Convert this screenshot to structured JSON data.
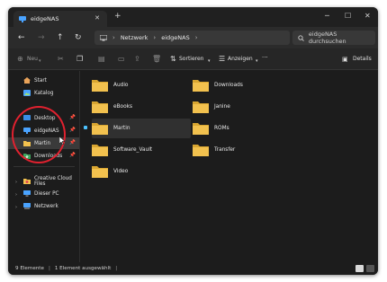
{
  "window": {
    "tab_title": "eidgeNAS",
    "close_tab": "✕",
    "new_tab": "+",
    "minimize": "─",
    "maximize": "☐",
    "close": "✕"
  },
  "nav": {
    "back": "←",
    "forward": "→",
    "up": "↑",
    "refresh": "↻",
    "breadcrumb": [
      "Netzwerk",
      "eidgeNAS"
    ],
    "search_placeholder": "eidgeNAS durchsuchen"
  },
  "toolbar": {
    "new_label": "Neu",
    "sort_label": "Sortieren",
    "view_label": "Anzeigen",
    "more_label": "···",
    "details_label": "Details"
  },
  "sidebar": {
    "items": [
      {
        "label": "Start",
        "icon": "home-icon"
      },
      {
        "label": "Katalog",
        "icon": "gallery-icon"
      },
      {
        "label": "Desktop",
        "icon": "desktop-icon",
        "pinned": true
      },
      {
        "label": "eidgeNAS",
        "icon": "network-drive-icon",
        "pinned": true
      },
      {
        "label": "Martin",
        "icon": "folder-icon",
        "pinned": true,
        "selected": true
      },
      {
        "label": "Downloads",
        "icon": "downloads-icon",
        "pinned": true
      },
      {
        "label": "Creative Cloud Files",
        "icon": "creative-cloud-icon"
      },
      {
        "label": "Dieser PC",
        "icon": "pc-icon"
      },
      {
        "label": "Netzwerk",
        "icon": "network-icon"
      }
    ]
  },
  "folders": [
    {
      "name": "Audio"
    },
    {
      "name": "Downloads"
    },
    {
      "name": "eBooks"
    },
    {
      "name": "Janine"
    },
    {
      "name": "Martin",
      "selected": true
    },
    {
      "name": "ROMs"
    },
    {
      "name": "Software_Vault"
    },
    {
      "name": "Transfer"
    },
    {
      "name": "Video"
    }
  ],
  "status": {
    "count": "9 Elemente",
    "selected": "1 Element ausgewählt"
  },
  "colors": {
    "accent": "#4cc2ff",
    "folder": "#f2c14e",
    "highlight_circle": "#e0212f"
  }
}
